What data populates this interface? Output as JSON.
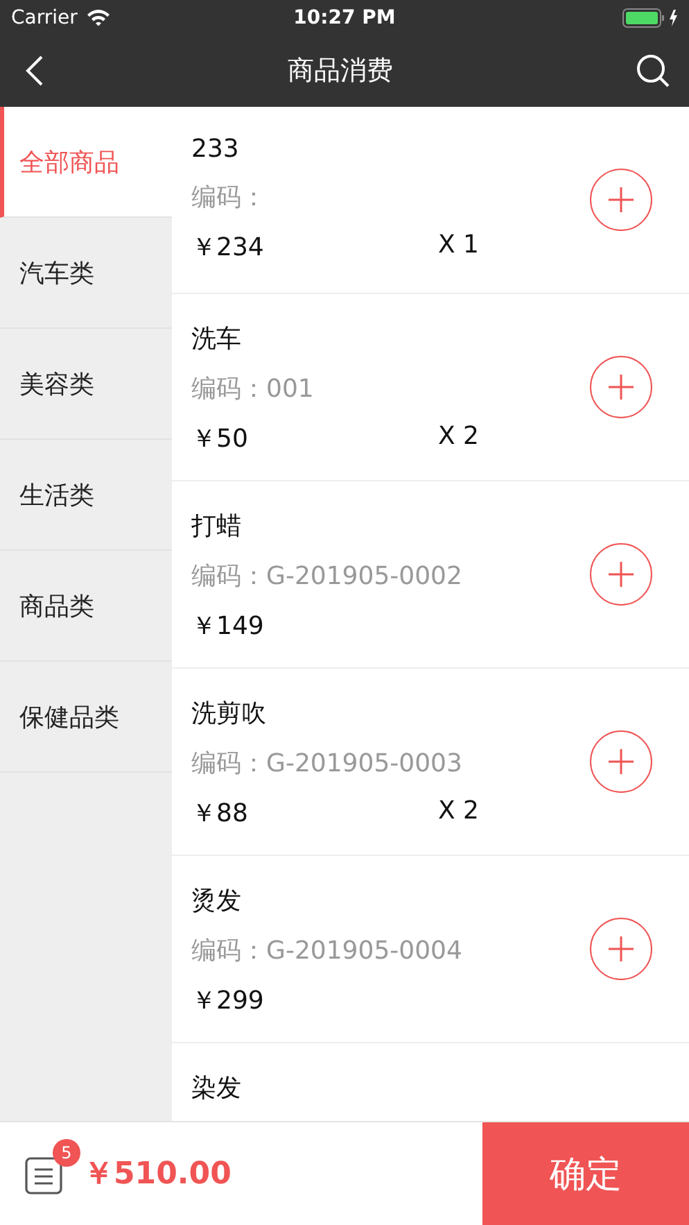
{
  "status_bar": {
    "carrier": "Carrier",
    "time": "10:27 PM"
  },
  "nav": {
    "title": "商品消费"
  },
  "categories": [
    {
      "label": "全部商品",
      "selected": true
    },
    {
      "label": "汽车类",
      "selected": false
    },
    {
      "label": "美容类",
      "selected": false
    },
    {
      "label": "生活类",
      "selected": false
    },
    {
      "label": "商品类",
      "selected": false
    },
    {
      "label": "保健品类",
      "selected": false
    }
  ],
  "products": [
    {
      "name": "233",
      "code": "编码：",
      "price": "￥234",
      "quantity": "X 1"
    },
    {
      "name": "洗车",
      "code": "编码：001",
      "price": "￥50",
      "quantity": "X 2"
    },
    {
      "name": "打蜡",
      "code": "编码：G-201905-0002",
      "price": "￥149"
    },
    {
      "name": "洗剪吹",
      "code": "编码：G-201905-0003",
      "price": "￥88",
      "quantity": "X 2"
    },
    {
      "name": "烫发",
      "code": "编码：G-201905-0004",
      "price": "￥299"
    },
    {
      "name": "染发"
    }
  ],
  "bottom_bar": {
    "badge": "5",
    "total": "￥510.00",
    "confirm": "确定"
  }
}
